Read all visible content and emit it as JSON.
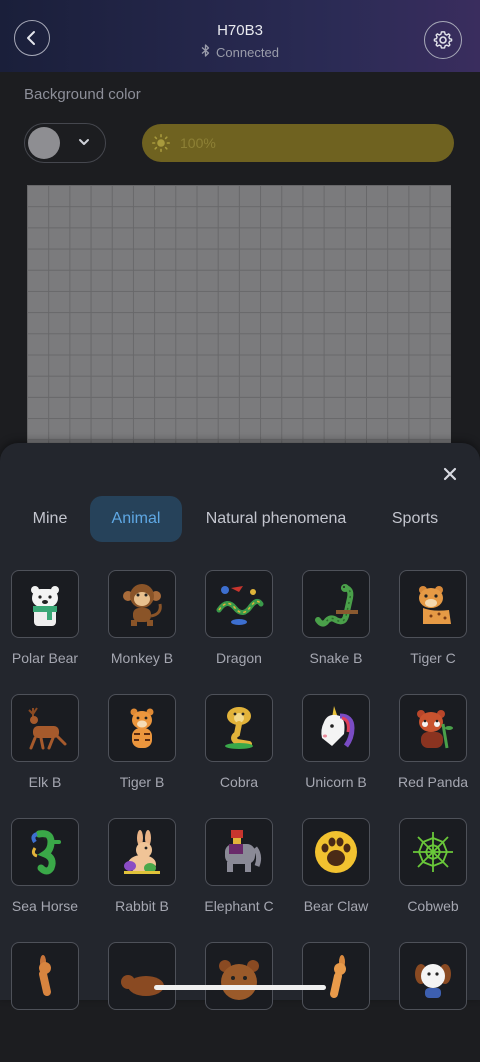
{
  "header": {
    "title": "H70B3",
    "status": "Connected",
    "back_icon": "chevron-left-icon",
    "settings_icon": "gear-icon",
    "bluetooth_icon": "bluetooth-icon"
  },
  "background": {
    "label": "Background color",
    "selected_color": "#8e8e92",
    "brightness": "100%",
    "brightness_color": "#6f6220"
  },
  "canvas": {
    "columns": 20,
    "rows": 13,
    "fill_color": "#7b7b7d"
  },
  "sheet": {
    "close_icon": "close-icon",
    "tabs": [
      {
        "label": "Mine",
        "active": false
      },
      {
        "label": "Animal",
        "active": true
      },
      {
        "label": "Natural phenomena",
        "active": false
      },
      {
        "label": "Sports",
        "active": false
      }
    ],
    "accent_color": "#5fa8e4",
    "items": [
      {
        "label": "Polar Bear",
        "icon": "polar-bear-icon"
      },
      {
        "label": "Monkey B",
        "icon": "monkey-icon"
      },
      {
        "label": "Dragon",
        "icon": "dragon-icon"
      },
      {
        "label": "Snake B",
        "icon": "snake-icon"
      },
      {
        "label": "Tiger C",
        "icon": "tiger-icon"
      },
      {
        "label": "Elk B",
        "icon": "elk-icon"
      },
      {
        "label": "Tiger B",
        "icon": "tiger-icon"
      },
      {
        "label": "Cobra",
        "icon": "cobra-icon"
      },
      {
        "label": "Unicorn B",
        "icon": "unicorn-icon"
      },
      {
        "label": "Red Panda",
        "icon": "red-panda-icon"
      },
      {
        "label": "Sea Horse",
        "icon": "seahorse-icon"
      },
      {
        "label": "Rabbit B",
        "icon": "rabbit-icon"
      },
      {
        "label": "Elephant C",
        "icon": "elephant-icon"
      },
      {
        "label": "Bear Claw",
        "icon": "bear-claw-icon"
      },
      {
        "label": "Cobweb",
        "icon": "cobweb-icon"
      },
      {
        "label": "",
        "icon": "kangaroo-icon"
      },
      {
        "label": "",
        "icon": "bear-icon"
      },
      {
        "label": "",
        "icon": "bear-face-icon"
      },
      {
        "label": "",
        "icon": "kangaroo-icon"
      },
      {
        "label": "",
        "icon": "dog-icon"
      }
    ]
  }
}
